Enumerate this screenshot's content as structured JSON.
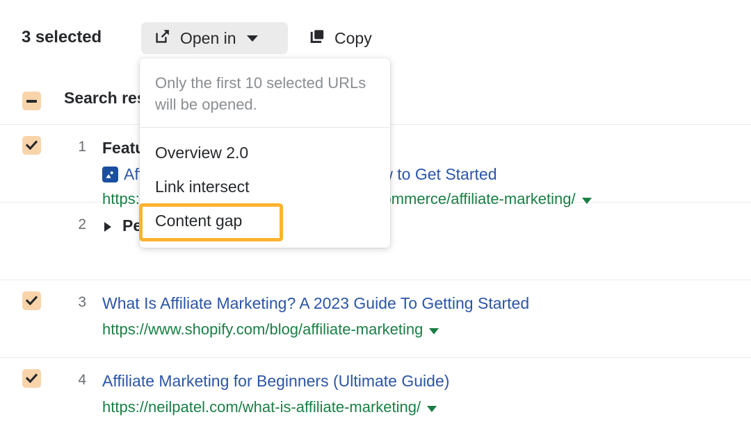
{
  "toolbar": {
    "selected_count_label": "3 selected",
    "open_in": {
      "label": "Open in",
      "icon": "external-link-icon",
      "caret": "chevron-down-icon"
    },
    "copy": {
      "label": "Copy",
      "icon": "copy-icon"
    }
  },
  "dropdown": {
    "note": "Only the first 10 selected URLs will be opened.",
    "items": [
      {
        "label": "Overview 2.0",
        "highlighted": false
      },
      {
        "label": "Link intersect",
        "highlighted": false
      },
      {
        "label": "Content gap",
        "highlighted": true
      }
    ]
  },
  "highlight": {
    "color": "#fbb330",
    "target_label": "Content gap"
  },
  "results": {
    "group_header": {
      "label": "Search results",
      "checkbox_state": "indeterminate"
    },
    "rows": [
      {
        "rank": "1",
        "checkbox_state": "checked",
        "feature_label": "Featured snippet",
        "serp_feature_icon": "image-result-icon",
        "title": "Affiliate Marketing: What it is and How to Get Started",
        "url": "https://www.bigcommerce.com/articles/ecommerce/affiliate-marketing/",
        "url_caret": "chevron-down-icon"
      },
      {
        "rank": "2",
        "checkbox_state": "none",
        "expand_icon": "triangle-right-icon",
        "group_label": "People also ask"
      },
      {
        "rank": "3",
        "checkbox_state": "checked",
        "title": "What Is Affiliate Marketing? A 2023 Guide To Getting Started",
        "url": "https://www.shopify.com/blog/affiliate-marketing",
        "url_caret": "chevron-down-icon"
      },
      {
        "rank": "4",
        "checkbox_state": "checked",
        "title": "Affiliate Marketing for Beginners (Ultimate Guide)",
        "url": "https://neilpatel.com/what-is-affiliate-marketing/",
        "url_caret": "chevron-down-icon"
      }
    ]
  },
  "colors": {
    "link": "#2b55a8",
    "url": "#1a7f45",
    "checkbox": "#f9d4ab",
    "highlight": "#fbb330",
    "button_bg": "#ebebeb"
  }
}
